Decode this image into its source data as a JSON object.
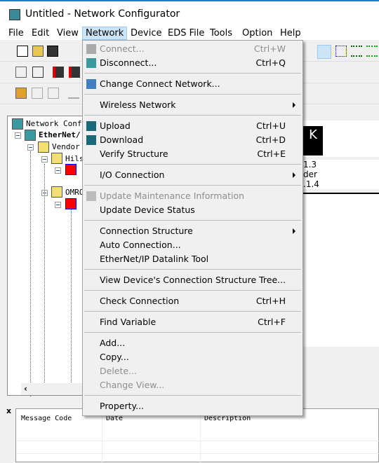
{
  "window": {
    "title": "Untitled - Network Configurator"
  },
  "menubar": [
    "File",
    "Edit",
    "View",
    "Network",
    "Device",
    "EDS File",
    "Tools",
    "Option",
    "Help"
  ],
  "menubar_active": "Network",
  "network_menu": [
    {
      "label": "Connect...",
      "shortcut": "Ctrl+W",
      "disabled": true,
      "icon": "connect-icon"
    },
    {
      "label": "Disconnect...",
      "shortcut": "Ctrl+Q",
      "icon": "disconnect-icon"
    },
    {
      "sep": true
    },
    {
      "label": "Change Connect Network...",
      "icon": "change-network-icon"
    },
    {
      "sep": true
    },
    {
      "label": "Wireless Network",
      "submenu": true
    },
    {
      "sep": true
    },
    {
      "label": "Upload",
      "shortcut": "Ctrl+U",
      "icon": "upload-icon"
    },
    {
      "label": "Download",
      "shortcut": "Ctrl+D",
      "icon": "download-icon"
    },
    {
      "label": "Verify Structure",
      "shortcut": "Ctrl+E"
    },
    {
      "sep": true
    },
    {
      "label": "I/O Connection",
      "submenu": true
    },
    {
      "sep": true
    },
    {
      "label": "Update Maintenance Information",
      "disabled": true,
      "icon": "maintenance-icon"
    },
    {
      "label": "Update Device Status"
    },
    {
      "sep": true
    },
    {
      "label": "Connection Structure",
      "submenu": true
    },
    {
      "label": "Auto Connection..."
    },
    {
      "label": "EtherNet/IP Datalink Tool"
    },
    {
      "sep": true
    },
    {
      "label": "View Device's Connection Structure Tree..."
    },
    {
      "sep": true
    },
    {
      "label": "Check Connection",
      "shortcut": "Ctrl+H"
    },
    {
      "sep": true
    },
    {
      "label": "Find Variable",
      "shortcut": "Ctrl+F"
    },
    {
      "sep": true
    },
    {
      "label": "Add..."
    },
    {
      "label": "Copy..."
    },
    {
      "label": "Delete...",
      "disabled": true
    },
    {
      "label": "Change View...",
      "disabled": true
    },
    {
      "sep": true
    },
    {
      "label": "Property..."
    }
  ],
  "tree": {
    "root": "Network Confi",
    "network": "EtherNet/",
    "vendor": "Vendor",
    "vendor1": "Hils",
    "vendor2": "OMRO"
  },
  "right_pane": {
    "device_letter": "K",
    "line1": "1.3",
    "line2": "der",
    "line3": ".1.4"
  },
  "messages": {
    "columns": [
      "Message Code",
      "Date",
      "Description"
    ],
    "close": "x"
  },
  "colors": {
    "menu_active_bg": "#cce4f7",
    "menu_bg": "#f0f0f0",
    "disabled_text": "#8d8d8d"
  }
}
